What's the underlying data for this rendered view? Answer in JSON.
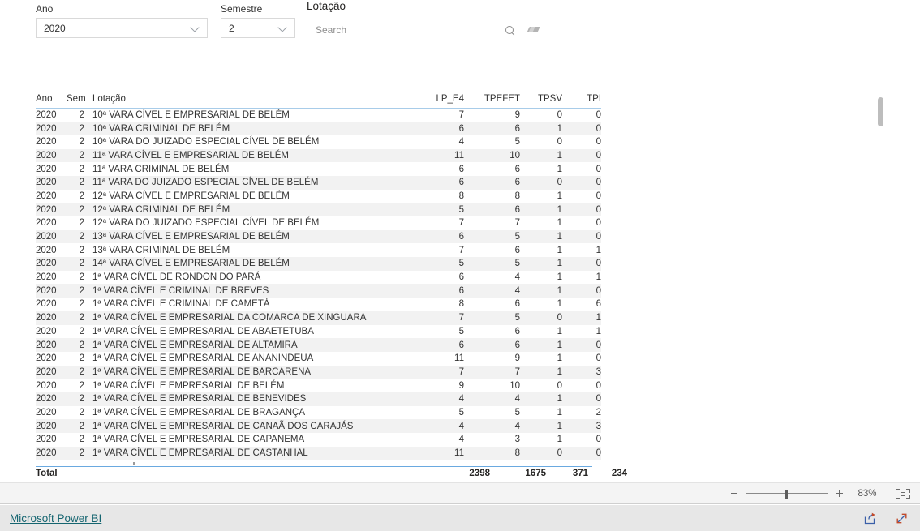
{
  "slicers": {
    "ano": {
      "label": "Ano",
      "value": "2020",
      "icon": "chevron-down-icon"
    },
    "semestre": {
      "label": "Semestre",
      "value": "2",
      "icon": "chevron-down-icon"
    },
    "lotacao": {
      "label": "Lotação",
      "search_placeholder": "Search",
      "search_value": "",
      "search_icon": "search-icon",
      "clear_icon": "eraser-icon"
    }
  },
  "table": {
    "columns": [
      {
        "key": "ano",
        "label": "Ano",
        "align": "left"
      },
      {
        "key": "sem",
        "label": "Sem",
        "align": "right"
      },
      {
        "key": "lotacao",
        "label": "Lotação",
        "align": "left"
      },
      {
        "key": "lp_e4",
        "label": "LP_E4",
        "align": "right"
      },
      {
        "key": "tpefet",
        "label": "TPEFET",
        "align": "right"
      },
      {
        "key": "tpsv",
        "label": "TPSV",
        "align": "right"
      },
      {
        "key": "tpi",
        "label": "TPI",
        "align": "right"
      }
    ],
    "rows": [
      {
        "ano": "2020",
        "sem": "2",
        "lotacao": "10ª VARA CÍVEL E EMPRESARIAL DE BELÉM",
        "lp_e4": "7",
        "tpefet": "9",
        "tpsv": "0",
        "tpi": "0"
      },
      {
        "ano": "2020",
        "sem": "2",
        "lotacao": "10ª VARA CRIMINAL DE BELÉM",
        "lp_e4": "6",
        "tpefet": "6",
        "tpsv": "1",
        "tpi": "0"
      },
      {
        "ano": "2020",
        "sem": "2",
        "lotacao": "10ª VARA DO JUIZADO ESPECIAL CÍVEL DE BELÉM",
        "lp_e4": "4",
        "tpefet": "5",
        "tpsv": "0",
        "tpi": "0"
      },
      {
        "ano": "2020",
        "sem": "2",
        "lotacao": "11ª VARA CÍVEL E EMPRESARIAL DE BELÉM",
        "lp_e4": "11",
        "tpefet": "10",
        "tpsv": "1",
        "tpi": "0"
      },
      {
        "ano": "2020",
        "sem": "2",
        "lotacao": "11ª VARA CRIMINAL DE BELÉM",
        "lp_e4": "6",
        "tpefet": "6",
        "tpsv": "1",
        "tpi": "0"
      },
      {
        "ano": "2020",
        "sem": "2",
        "lotacao": "11ª VARA DO JUIZADO ESPECIAL CÍVEL DE BELÉM",
        "lp_e4": "6",
        "tpefet": "6",
        "tpsv": "0",
        "tpi": "0"
      },
      {
        "ano": "2020",
        "sem": "2",
        "lotacao": "12ª VARA CÍVEL E EMPRESARIAL DE BELÉM",
        "lp_e4": "8",
        "tpefet": "8",
        "tpsv": "1",
        "tpi": "0"
      },
      {
        "ano": "2020",
        "sem": "2",
        "lotacao": "12ª VARA CRIMINAL DE BELÉM",
        "lp_e4": "5",
        "tpefet": "6",
        "tpsv": "1",
        "tpi": "0"
      },
      {
        "ano": "2020",
        "sem": "2",
        "lotacao": "12ª VARA DO JUIZADO ESPECIAL CÍVEL DE BELÉM",
        "lp_e4": "7",
        "tpefet": "7",
        "tpsv": "1",
        "tpi": "0"
      },
      {
        "ano": "2020",
        "sem": "2",
        "lotacao": "13ª VARA CÍVEL E EMPRESARIAL DE BELÉM",
        "lp_e4": "6",
        "tpefet": "5",
        "tpsv": "1",
        "tpi": "0"
      },
      {
        "ano": "2020",
        "sem": "2",
        "lotacao": "13ª VARA CRIMINAL DE BELÉM",
        "lp_e4": "7",
        "tpefet": "6",
        "tpsv": "1",
        "tpi": "1"
      },
      {
        "ano": "2020",
        "sem": "2",
        "lotacao": "14ª VARA CÍVEL E EMPRESARIAL DE BELÉM",
        "lp_e4": "5",
        "tpefet": "5",
        "tpsv": "1",
        "tpi": "0"
      },
      {
        "ano": "2020",
        "sem": "2",
        "lotacao": "1ª VARA CÍVEL DE RONDON DO PARÁ",
        "lp_e4": "6",
        "tpefet": "4",
        "tpsv": "1",
        "tpi": "1"
      },
      {
        "ano": "2020",
        "sem": "2",
        "lotacao": "1ª VARA CÍVEL E CRIMINAL DE BREVES",
        "lp_e4": "6",
        "tpefet": "4",
        "tpsv": "1",
        "tpi": "0"
      },
      {
        "ano": "2020",
        "sem": "2",
        "lotacao": "1ª VARA CÍVEL E CRIMINAL DE CAMETÁ",
        "lp_e4": "8",
        "tpefet": "6",
        "tpsv": "1",
        "tpi": "6"
      },
      {
        "ano": "2020",
        "sem": "2",
        "lotacao": "1ª VARA CÍVEL E EMPRESARIAL DA COMARCA DE XINGUARA",
        "lp_e4": "7",
        "tpefet": "5",
        "tpsv": "0",
        "tpi": "1"
      },
      {
        "ano": "2020",
        "sem": "2",
        "lotacao": "1ª VARA CÍVEL E EMPRESARIAL DE ABAETETUBA",
        "lp_e4": "5",
        "tpefet": "6",
        "tpsv": "1",
        "tpi": "1"
      },
      {
        "ano": "2020",
        "sem": "2",
        "lotacao": "1ª VARA CÍVEL E EMPRESARIAL DE ALTAMIRA",
        "lp_e4": "6",
        "tpefet": "6",
        "tpsv": "1",
        "tpi": "0"
      },
      {
        "ano": "2020",
        "sem": "2",
        "lotacao": "1ª VARA CÍVEL E EMPRESARIAL DE ANANINDEUA",
        "lp_e4": "11",
        "tpefet": "9",
        "tpsv": "1",
        "tpi": "0"
      },
      {
        "ano": "2020",
        "sem": "2",
        "lotacao": "1ª VARA CÍVEL E EMPRESARIAL DE BARCARENA",
        "lp_e4": "7",
        "tpefet": "7",
        "tpsv": "1",
        "tpi": "3"
      },
      {
        "ano": "2020",
        "sem": "2",
        "lotacao": "1ª VARA CÍVEL E EMPRESARIAL DE BELÉM",
        "lp_e4": "9",
        "tpefet": "10",
        "tpsv": "0",
        "tpi": "0"
      },
      {
        "ano": "2020",
        "sem": "2",
        "lotacao": "1ª VARA CÍVEL E EMPRESARIAL DE BENEVIDES",
        "lp_e4": "4",
        "tpefet": "4",
        "tpsv": "1",
        "tpi": "0"
      },
      {
        "ano": "2020",
        "sem": "2",
        "lotacao": "1ª VARA CÍVEL E EMPRESARIAL DE BRAGANÇA",
        "lp_e4": "5",
        "tpefet": "5",
        "tpsv": "1",
        "tpi": "2"
      },
      {
        "ano": "2020",
        "sem": "2",
        "lotacao": "1ª VARA CÍVEL E EMPRESARIAL DE CANAÃ DOS CARAJÁS",
        "lp_e4": "4",
        "tpefet": "4",
        "tpsv": "1",
        "tpi": "3"
      },
      {
        "ano": "2020",
        "sem": "2",
        "lotacao": "1ª VARA CÍVEL E EMPRESARIAL DE CAPANEMA",
        "lp_e4": "4",
        "tpefet": "3",
        "tpsv": "1",
        "tpi": "0"
      },
      {
        "ano": "2020",
        "sem": "2",
        "lotacao": "1ª VARA CÍVEL E EMPRESARIAL DE CASTANHAL",
        "lp_e4": "11",
        "tpefet": "8",
        "tpsv": "0",
        "tpi": "0"
      }
    ],
    "total": {
      "label": "Total",
      "lp_e4": "2398",
      "tpefet": "1675",
      "tpsv": "371",
      "tpi": "234"
    }
  },
  "zoombar": {
    "minus_icon": "minus-icon",
    "plus_icon": "plus-icon",
    "percent": "83%",
    "fit_icon": "fit-to-page-icon"
  },
  "footer": {
    "brand": "Microsoft Power BI",
    "share_icon": "share-icon",
    "fullscreen_icon": "fullscreen-icon"
  },
  "colors": {
    "header_rule": "#a8cce9",
    "total_rule": "#6aa9e0",
    "alt_row": "#f2f2f2",
    "brand_link": "#156570",
    "footer_bg": "#e7e7e7"
  }
}
